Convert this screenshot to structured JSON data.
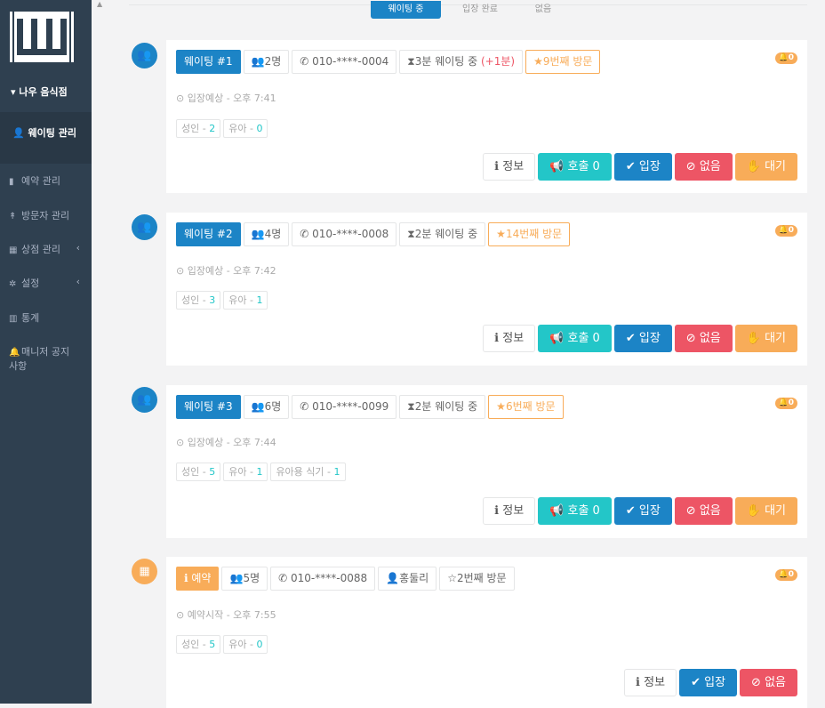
{
  "sidebar": {
    "store_name": "▾ 나우 음식점",
    "active_item": "웨이팅 관리",
    "items": [
      {
        "label": "예약 관리",
        "icon": "bookmark-icon"
      },
      {
        "label": "방문자 관리",
        "icon": "pin-icon"
      },
      {
        "label": "상점 관리",
        "icon": "building-icon",
        "chevron": "‹"
      },
      {
        "label": "설정",
        "icon": "gear-icon",
        "chevron": "‹"
      },
      {
        "label": "통계",
        "icon": "bar-chart-icon"
      },
      {
        "label": "매니저 공지사항",
        "icon": "bell-icon"
      }
    ]
  },
  "tabs": [
    "웨이팅 중",
    "입장 완료",
    "없음"
  ],
  "cards": [
    {
      "type": "waiting",
      "number_label": "웨이팅 #1",
      "people": "2명",
      "phone": "010-****-0004",
      "wait": "3분 웨이팅 중",
      "wait_extra": "(+1분)",
      "visits": "9번째 방문",
      "bell": "0",
      "eta": "입장예상 - 오후 7:41",
      "guests": [
        {
          "label": "성인",
          "count": "2"
        },
        {
          "label": "유아",
          "count": "0"
        }
      ]
    },
    {
      "type": "waiting",
      "number_label": "웨이팅 #2",
      "people": "4명",
      "phone": "010-****-0008",
      "wait": "2분 웨이팅 중",
      "wait_extra": "",
      "visits": "14번째 방문",
      "bell": "0",
      "eta": "입장예상 - 오후 7:42",
      "guests": [
        {
          "label": "성인",
          "count": "3"
        },
        {
          "label": "유아",
          "count": "1"
        }
      ]
    },
    {
      "type": "waiting",
      "number_label": "웨이팅 #3",
      "people": "6명",
      "phone": "010-****-0099",
      "wait": "2분 웨이팅 중",
      "wait_extra": "",
      "visits": "6번째 방문",
      "bell": "0",
      "eta": "입장예상 - 오후 7:44",
      "guests": [
        {
          "label": "성인",
          "count": "5"
        },
        {
          "label": "유아",
          "count": "1"
        },
        {
          "label": "유아용 식기",
          "count": "1"
        }
      ]
    },
    {
      "type": "reservation",
      "number_label": "예약",
      "people": "5명",
      "phone": "010-****-0088",
      "name": "홍둘리",
      "visits": "2번째 방문",
      "bell": "0",
      "eta": "예약시작 - 오후 7:55",
      "guests": [
        {
          "label": "성인",
          "count": "5"
        },
        {
          "label": "유아",
          "count": "0"
        }
      ]
    }
  ],
  "buttons": {
    "info": "정보",
    "call": "호출 0",
    "enter": "입장",
    "none": "없음",
    "wait": "대기"
  },
  "colors": {
    "sidebar": "#2f4050",
    "primary": "#1c84c6",
    "teal": "#23c6c8",
    "danger": "#ed5565",
    "warning": "#f8ac59"
  }
}
